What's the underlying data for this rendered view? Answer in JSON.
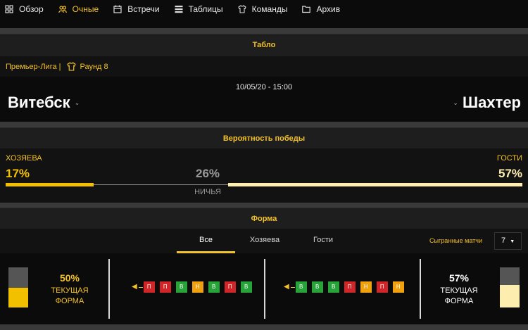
{
  "nav": {
    "items": [
      {
        "label": "Обзор",
        "icon": "overview-icon"
      },
      {
        "label": "Очные",
        "icon": "head-to-head-icon",
        "active": true
      },
      {
        "label": "Встречи",
        "icon": "calendar-icon"
      },
      {
        "label": "Таблицы",
        "icon": "table-icon"
      },
      {
        "label": "Команды",
        "icon": "shirt-icon"
      },
      {
        "label": "Архив",
        "icon": "folder-icon"
      }
    ]
  },
  "tablo": {
    "title": "Табло",
    "league": "Премьер-Лига |",
    "round": "Раунд 8",
    "datetime": "10/05/20 - 15:00",
    "home_team": "Витебск",
    "away_team": "Шахтер"
  },
  "probability": {
    "title": "Вероятность победы",
    "home_label": "ХОЗЯЕВА",
    "home_value": "17%",
    "draw_value": "26%",
    "draw_label": "НИЧЬЯ",
    "away_label": "ГОСТИ",
    "away_value": "57%",
    "home_fraction": 0.17,
    "draw_fraction": 0.26,
    "away_fraction": 0.57
  },
  "form": {
    "title": "Форма",
    "tabs": [
      "Все",
      "Хозяева",
      "Гости"
    ],
    "played_label": "Сыгранные матчи",
    "played_value": "7",
    "home": {
      "percent": "50%",
      "caption": "ТЕКУЩАЯ ФОРМА",
      "fraction": 0.5,
      "results": [
        "П",
        "П",
        "В",
        "Н",
        "В",
        "П",
        "В"
      ]
    },
    "away": {
      "percent": "57%",
      "caption": "ТЕКУЩАЯ ФОРМА",
      "fraction": 0.57,
      "results": [
        "В",
        "В",
        "В",
        "П",
        "Н",
        "П",
        "Н"
      ]
    }
  },
  "colors": {
    "accent": "#f3c12a",
    "home_bar": "#f3c000",
    "away_bar": "#fdeeb0",
    "win": "#27a33a",
    "loss": "#d0262a",
    "draw": "#f0a20e"
  }
}
